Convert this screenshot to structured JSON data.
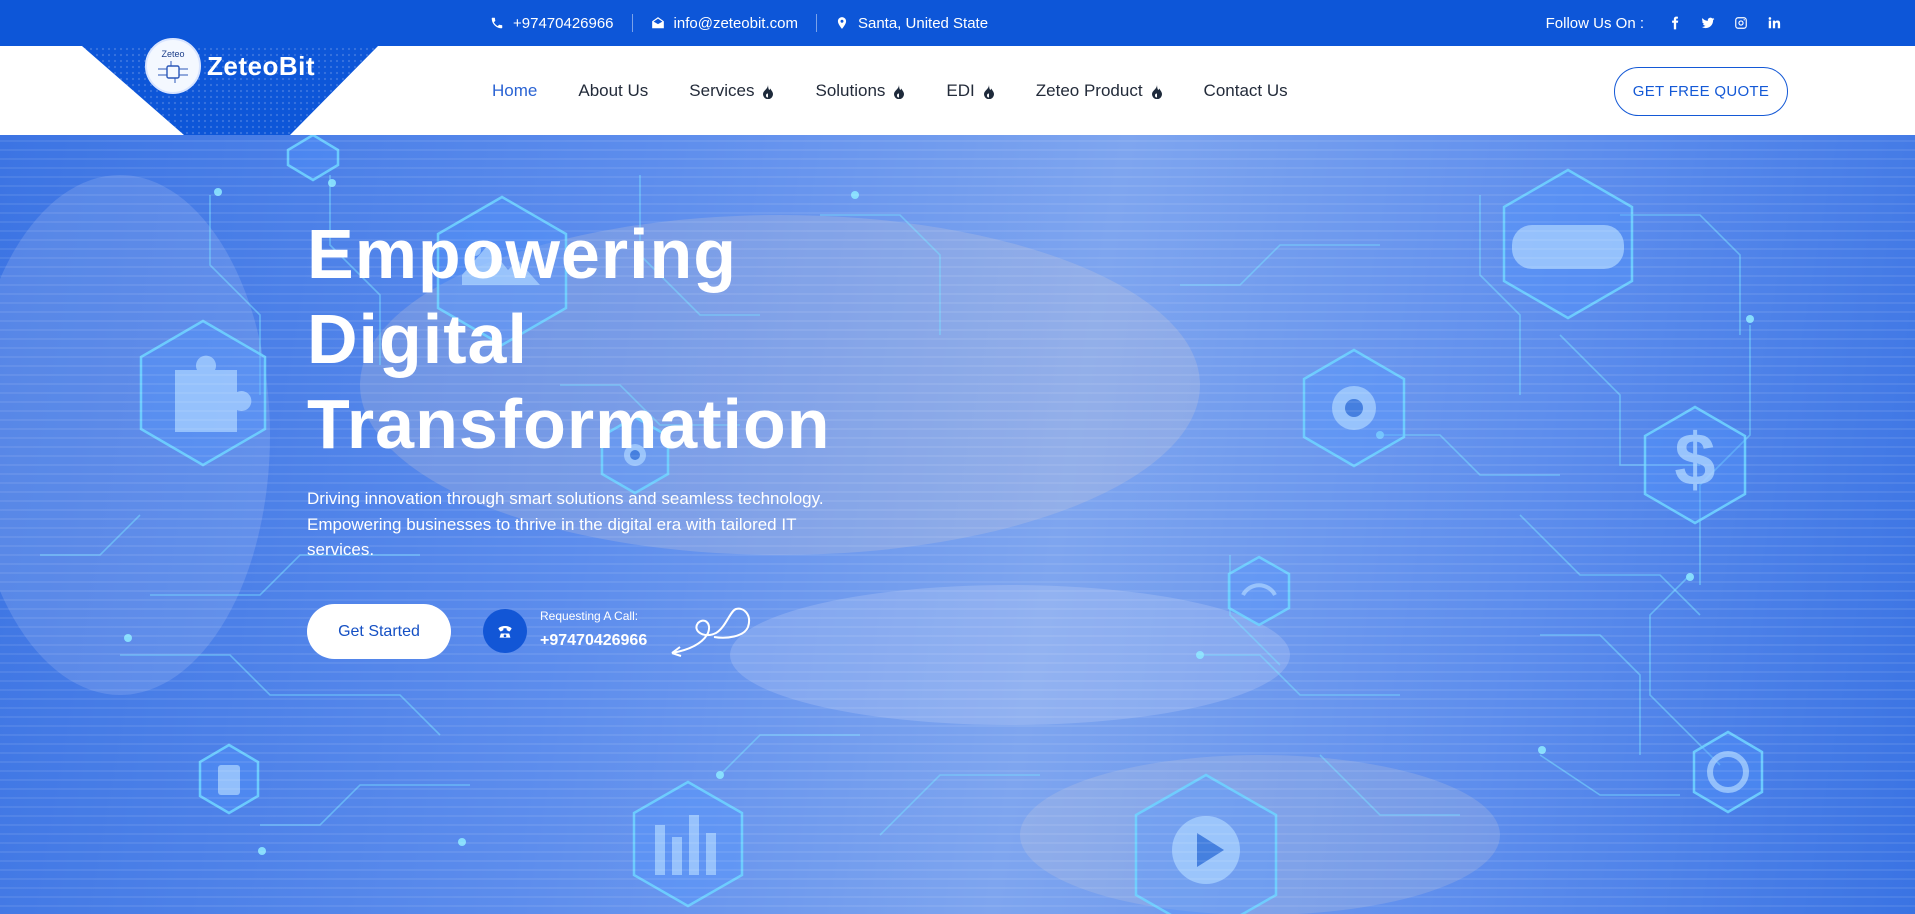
{
  "topbar": {
    "phone": "+97470426966",
    "email": "info@zeteobit.com",
    "location": "Santa, United State",
    "follow_label": "Follow Us On :",
    "social": [
      "facebook-icon",
      "twitter-icon",
      "instagram-icon",
      "linkedin-icon"
    ]
  },
  "brand": {
    "name": "ZeteoBit",
    "badge_text": "Zeteo"
  },
  "nav": {
    "items": [
      {
        "label": "Home",
        "active": true,
        "dropdown": false
      },
      {
        "label": "About Us",
        "active": false,
        "dropdown": false
      },
      {
        "label": "Services",
        "active": false,
        "dropdown": true
      },
      {
        "label": "Solutions",
        "active": false,
        "dropdown": true
      },
      {
        "label": "EDI",
        "active": false,
        "dropdown": true
      },
      {
        "label": "Zeteo Product",
        "active": false,
        "dropdown": true
      },
      {
        "label": "Contact Us",
        "active": false,
        "dropdown": false
      }
    ],
    "quote_button": "GET FREE QUOTE"
  },
  "hero": {
    "title_lines": [
      "Empowering",
      "Digital",
      "Transformation"
    ],
    "subtitle": "Driving innovation through smart solutions and seamless technology. Empowering businesses to thrive in the digital era with tailored IT services.",
    "cta_label": "Get Started",
    "call_label": "Requesting A Call:",
    "call_number": "+97470426966"
  },
  "colors": {
    "primary": "#0d56d8",
    "active_nav": "#2a63d3",
    "text_dark": "#232b3a",
    "white": "#ffffff"
  }
}
